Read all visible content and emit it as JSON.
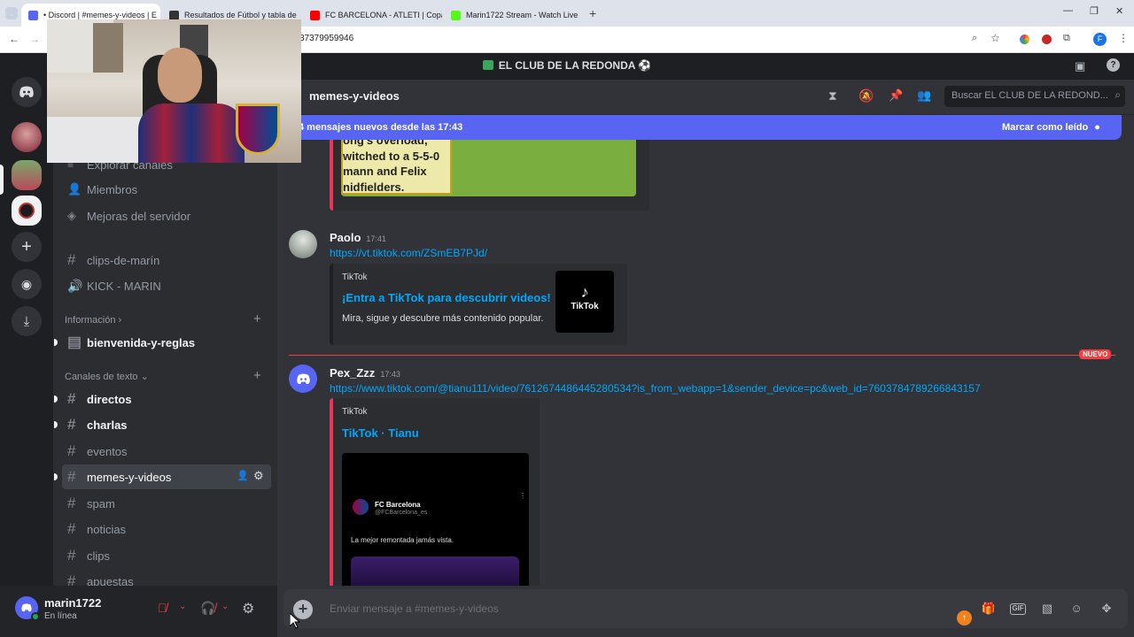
{
  "browser": {
    "tabs": [
      {
        "title": "• Discord | #memes-y-videos | E",
        "color": "#5865f2"
      },
      {
        "title": "Resultados de Fútbol y tabla de",
        "color": "#333333"
      },
      {
        "title": "FC BARCELONA - ATLETI | Copa",
        "color": "#ff0000"
      },
      {
        "title": "Marin1722 Stream - Watch Live",
        "color": "#53fc18"
      }
    ],
    "url": "37379959946",
    "profile_initial": "F"
  },
  "server": {
    "name": "EL CLUB DE LA REDONDA ⚽"
  },
  "channels": {
    "top_items": [
      {
        "label": "Explorar canales",
        "icon": "explore-icon"
      },
      {
        "label": "Miembros",
        "icon": "members-icon"
      },
      {
        "label": "Mejoras del servidor",
        "icon": "boost-icon"
      }
    ],
    "voice_items": [
      {
        "label": "clips-de-marín",
        "icon": "hash-icon"
      },
      {
        "label": "KICK - MARIN",
        "icon": "speaker-icon"
      }
    ],
    "info_category": "Información",
    "info_items": [
      {
        "label": "bienvenida-y-reglas"
      }
    ],
    "text_category": "Canales de texto",
    "text_items": [
      {
        "label": "directos"
      },
      {
        "label": "charlas"
      },
      {
        "label": "eventos"
      },
      {
        "label": "memes-y-videos"
      },
      {
        "label": "spam"
      },
      {
        "label": "noticias"
      },
      {
        "label": "clips"
      },
      {
        "label": "apuestas"
      }
    ]
  },
  "user": {
    "name": "marin1722",
    "status": "En línea"
  },
  "header": {
    "channel": "memes-y-videos",
    "search_placeholder": "Buscar EL CLUB DE LA REDOND..."
  },
  "banner": {
    "text": "4 mensajes nuevos desde las 17:43",
    "action": "Marcar como leído"
  },
  "messages": {
    "prev_image_lines": [
      "ong's overload,",
      "witched to a 5-5-0",
      "mann and Felix",
      "nidfielders."
    ],
    "m1": {
      "author": "Paolo",
      "time": "17:41",
      "link": "https://vt.tiktok.com/ZSmEB7PJd/",
      "embed": {
        "provider": "TikTok",
        "title": "¡Entra a TikTok para descubrir videos!",
        "desc": "Mira, sigue y descubre más contenido popular.",
        "thumb_label": "TikTok"
      }
    },
    "divider": "NUEVO",
    "m2": {
      "author": "Pex_Zzz",
      "time": "17:43",
      "link": "https://www.tiktok.com/@tianu111/video/7612674486445280534?is_from_webapp=1&sender_device=pc&web_id=7603784789266843157",
      "embed": {
        "provider": "TikTok",
        "title": "TikTok · Tianu",
        "video_account": "FC Barcelona",
        "video_handle": "@FCBarcelona_es",
        "video_text": "La mejor remontada jamás vista."
      }
    }
  },
  "composer": {
    "placeholder": "Enviar mensaje a #memes-y-videos"
  }
}
